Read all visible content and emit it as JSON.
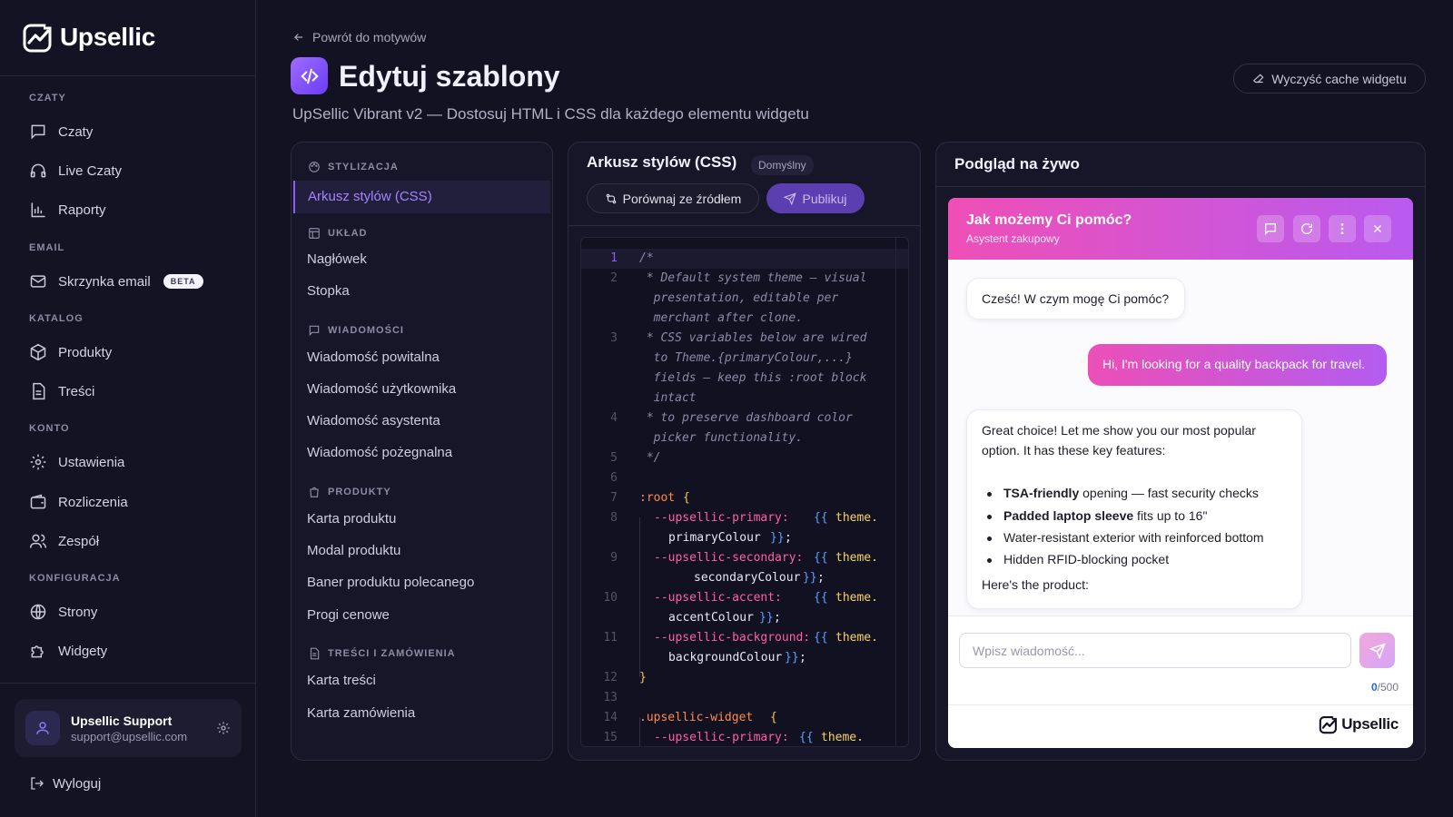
{
  "sidebar": {
    "logo": "Upsellic",
    "sections": {
      "czaty": "CZATY",
      "email": "EMAIL",
      "katalog": "KATALOG",
      "konto": "KONTO",
      "konfiguracja": "KONFIGURACJA"
    },
    "items": {
      "czaty": "Czaty",
      "live_czaty": "Live Czaty",
      "raporty": "Raporty",
      "skrzynka": "Skrzynka email",
      "beta": "BETA",
      "produkty": "Produkty",
      "tresci": "Treści",
      "ustawienia": "Ustawienia",
      "rozliczenia": "Rozliczenia",
      "zespol": "Zespół",
      "strony": "Strony",
      "widgety": "Widgety"
    },
    "user": {
      "name": "Upsellic Support",
      "email": "support@upsellic.com"
    },
    "logout": "Wyloguj"
  },
  "header": {
    "back": "Powrót do motywów",
    "title": "Edytuj szablony",
    "subtitle": "UpSellic Vibrant v2 — Dostosuj HTML i CSS dla każdego elementu widgetu",
    "cache_button": "Wyczyść cache widgetu"
  },
  "elements_panel": {
    "groups": {
      "stylizacja": "STYLIZACJA",
      "uklad": "UKŁAD",
      "wiadomosci": "WIADOMOŚCI",
      "produkty": "PRODUKTY",
      "tresci": "TREŚCI I ZAMÓWIENIA"
    },
    "active": "Arkusz stylów (CSS)",
    "items": {
      "naglowek": "Nagłówek",
      "stopka": "Stopka",
      "powitalna": "Wiadomość powitalna",
      "uzytkownika": "Wiadomość użytkownika",
      "asystenta": "Wiadomość asystenta",
      "pozegnalna": "Wiadomość pożegnalna",
      "karta_produktu": "Karta produktu",
      "modal_produktu": "Modal produktu",
      "baner": "Baner produktu polecanego",
      "progi": "Progi cenowe",
      "karta_tresci": "Karta treści",
      "karta_zamowienia": "Karta zamówienia"
    }
  },
  "editor": {
    "title": "Arkusz stylów (CSS)",
    "badge": "Domyślny",
    "compare_button": "Porównaj ze źródłem",
    "publish_button": "Publikuj",
    "code": {
      "l1": "/*",
      "l2a": " * Default system theme — visual",
      "l2b": "  presentation, editable per",
      "l2c": "  merchant after clone.",
      "l3a": " * CSS variables below are wired",
      "l3b": "  to Theme.{primaryColour,...}",
      "l3c": "  fields — keep this :root block",
      "l3d": "  intact",
      "l4a": " * to preserve dashboard color",
      "l4b": "  picker functionality.",
      "l5": " */",
      "l7_sel": ":root",
      "brace_open": "{",
      "brace_close": "}",
      "var_primary": "--upsellic-primary:",
      "var_secondary": "--upsellic-secondary:",
      "var_accent": "--upsellic-accent:",
      "var_background": "--upsellic-background:",
      "tpl_open": "{{",
      "tpl_close": "}}",
      "theme": "theme.",
      "primaryColour": "primaryColour",
      "secondaryColour": "secondaryColour",
      "accentColour": "accentColour",
      "backgroundColour": "backgroundColour",
      "semicolon": ";",
      "l14_sel": ".upsellic-widget",
      "line_numbers": [
        "1",
        "2",
        "3",
        "4",
        "5",
        "6",
        "7",
        "8",
        "9",
        "10",
        "11",
        "12",
        "13",
        "14",
        "15"
      ]
    }
  },
  "preview": {
    "title": "Podgląd na żywo",
    "widget": {
      "title": "Jak możemy Ci pomóc?",
      "subtitle": "Asystent zakupowy",
      "greeting": "Cześć! W czym mogę Ci pomóc?",
      "user_message": "Hi, I'm looking for a quality backpack for travel.",
      "reply_intro_1": "Great choice! Let me show you our most popular",
      "reply_intro_2": "option. It has these key features:",
      "features": [
        {
          "bold": "TSA-friendly",
          "rest": " opening — fast security checks"
        },
        {
          "bold": "Padded laptop sleeve",
          "rest": " fits up to 16\""
        },
        {
          "bold": "",
          "rest": "Water-resistant exterior with reinforced bottom"
        },
        {
          "bold": "",
          "rest": "Hidden RFID-blocking pocket"
        }
      ],
      "reply_outro": "Here's the product:",
      "input_placeholder": "Wpisz wiadomość...",
      "counter_current": "0",
      "counter_max": "/500",
      "brand": "Upsellic"
    }
  },
  "colors": {
    "accent": "#8b5cf6",
    "gradient_start": "#ef4fb6",
    "gradient_end": "#b95aef"
  }
}
